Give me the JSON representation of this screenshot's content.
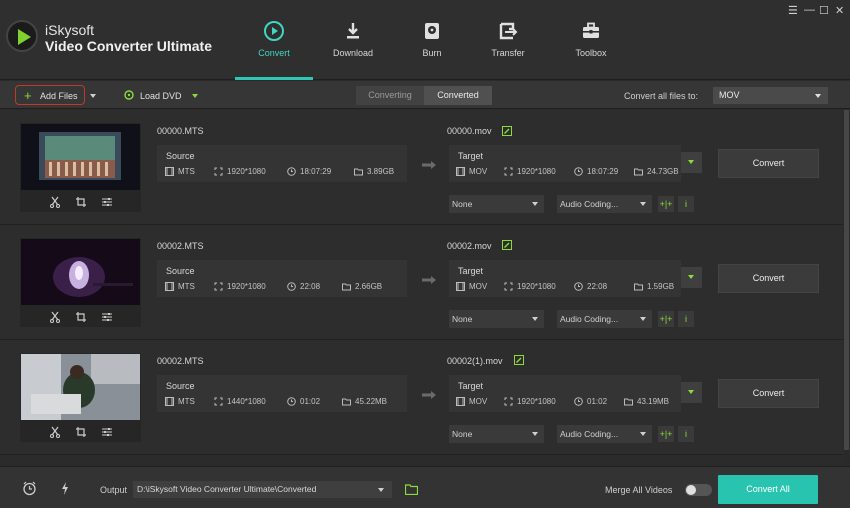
{
  "app": {
    "brand_line1": "iSkysoft",
    "brand_line2": "Video Converter Ultimate",
    "window_controls": [
      "☰",
      "—",
      "☐",
      "✕"
    ]
  },
  "nav": {
    "tabs": [
      {
        "label": "Convert",
        "icon": "convert-icon",
        "active": true
      },
      {
        "label": "Download",
        "icon": "download-icon"
      },
      {
        "label": "Burn",
        "icon": "burn-disc-icon"
      },
      {
        "label": "Transfer",
        "icon": "transfer-icon"
      },
      {
        "label": "Toolbox",
        "icon": "toolbox-icon"
      }
    ]
  },
  "toolbar": {
    "add_files": "Add Files",
    "load_dvd": "Load DVD",
    "seg_converting": "Converting",
    "seg_converted": "Converted",
    "convert_all_to": "Convert all files to:",
    "format": "MOV"
  },
  "files": [
    {
      "source_name": "00000.MTS",
      "source": {
        "title": "Source",
        "format": "MTS",
        "resolution": "1920*1080",
        "duration": "18:07:29",
        "size": "3.89GB"
      },
      "target_name": "00000.mov",
      "target": {
        "title": "Target",
        "format": "MOV",
        "resolution": "1920*1080",
        "duration": "18:07:29",
        "size": "24.73GB"
      },
      "subtitle": "None",
      "audio": "Audio Coding...",
      "convert": "Convert"
    },
    {
      "source_name": "00002.MTS",
      "source": {
        "title": "Source",
        "format": "MTS",
        "resolution": "1920*1080",
        "duration": "22:08",
        "size": "2.66GB"
      },
      "target_name": "00002.mov",
      "target": {
        "title": "Target",
        "format": "MOV",
        "resolution": "1920*1080",
        "duration": "22:08",
        "size": "1.59GB"
      },
      "subtitle": "None",
      "audio": "Audio Coding...",
      "convert": "Convert"
    },
    {
      "source_name": "00002.MTS",
      "source": {
        "title": "Source",
        "format": "MTS",
        "resolution": "1440*1080",
        "duration": "01:02",
        "size": "45.22MB"
      },
      "target_name": "00002(1).mov",
      "target": {
        "title": "Target",
        "format": "MOV",
        "resolution": "1920*1080",
        "duration": "01:02",
        "size": "43.19MB"
      },
      "subtitle": "None",
      "audio": "Audio Coding...",
      "convert": "Convert"
    }
  ],
  "bottom": {
    "output_label": "Output",
    "output_path": "D:\\iSkysoft Video Converter Ultimate\\Converted",
    "merge_label": "Merge All Videos",
    "convert_all": "Convert All"
  },
  "colors": {
    "accent": "#2ec7b4",
    "green": "#8bdc3a",
    "highlight": "#c0392b"
  }
}
